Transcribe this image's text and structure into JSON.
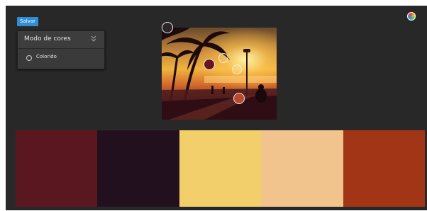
{
  "toolbar": {
    "save_label": "Salvar"
  },
  "mode_panel": {
    "title": "Modo de cores",
    "options": [
      {
        "label": "Colorido",
        "selected": false
      }
    ]
  },
  "icons": {
    "color_wheel": "color-wheel-icon",
    "panel_toggle": "chevron-double-down-icon",
    "radio": "radio-icon"
  },
  "palette": {
    "swatches": [
      "#5b1720",
      "#23101f",
      "#f2cf6a",
      "#f1c48d",
      "#a13516"
    ]
  },
  "accent_color": "#2f8ed6"
}
